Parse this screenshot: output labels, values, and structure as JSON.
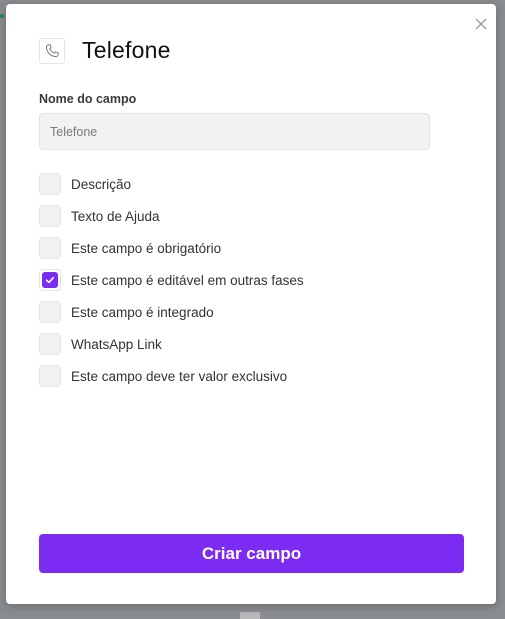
{
  "modal": {
    "title": "Telefone",
    "field_icon": "phone-icon",
    "close_icon": "close-icon"
  },
  "field_name": {
    "label": "Nome do campo",
    "value": "",
    "placeholder": "Telefone"
  },
  "options": [
    {
      "label": "Descrição",
      "checked": false
    },
    {
      "label": "Texto de Ajuda",
      "checked": false
    },
    {
      "label": "Este campo é obrigatório",
      "checked": false
    },
    {
      "label": "Este campo é editável em outras fases",
      "checked": true
    },
    {
      "label": "Este campo é integrado",
      "checked": false
    },
    {
      "label": "WhatsApp Link",
      "checked": false
    },
    {
      "label": "Este campo deve ter valor exclusivo",
      "checked": false
    }
  ],
  "submit_label": "Criar campo",
  "colors": {
    "accent": "#7b2bf2",
    "overlay": "#8a8d90"
  }
}
